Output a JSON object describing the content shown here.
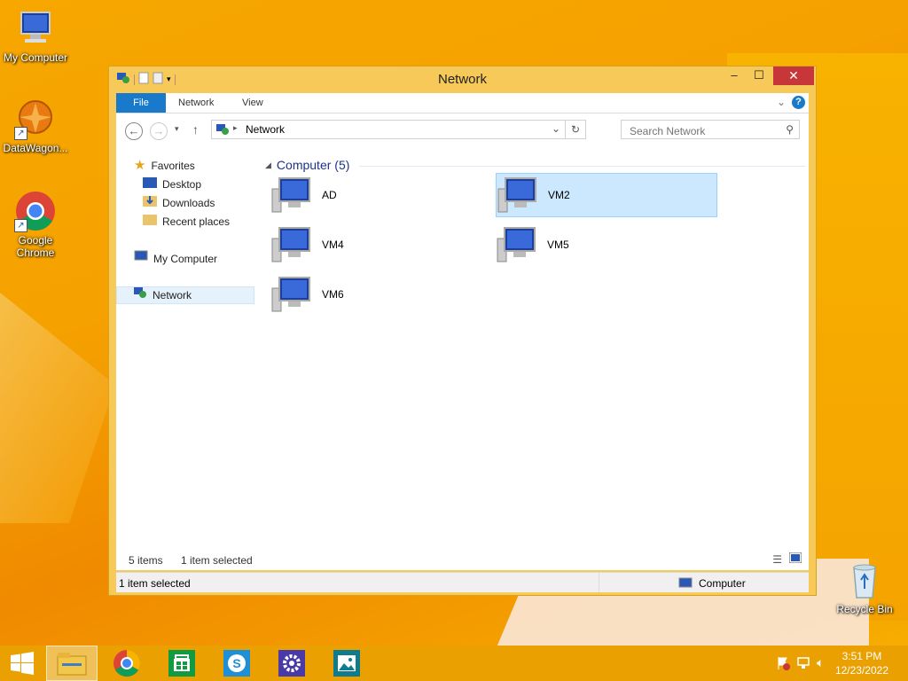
{
  "desktop": {
    "icons": [
      {
        "label": "My Computer"
      },
      {
        "label": "DataWagon..."
      },
      {
        "label": "Google Chrome"
      },
      {
        "label": "Recycle Bin"
      }
    ]
  },
  "window": {
    "title": "Network",
    "controls": {
      "minimize": "–",
      "maximize": "☐",
      "close": "✕"
    }
  },
  "ribbon": {
    "tabs": [
      {
        "label": "File"
      },
      {
        "label": "Network"
      },
      {
        "label": "View"
      }
    ],
    "help": "?"
  },
  "address": {
    "path": "Network",
    "search_placeholder": "Search Network"
  },
  "nav_pane": {
    "favorites": "Favorites",
    "favorite_items": [
      {
        "label": "Desktop"
      },
      {
        "label": "Downloads"
      },
      {
        "label": "Recent places"
      }
    ],
    "my_computer": "My Computer",
    "network": "Network"
  },
  "main": {
    "group_header": "Computer (5)",
    "items": [
      {
        "label": "AD",
        "selected": false
      },
      {
        "label": "VM2",
        "selected": true
      },
      {
        "label": "VM4",
        "selected": false
      },
      {
        "label": "VM5",
        "selected": false
      },
      {
        "label": "VM6",
        "selected": false
      }
    ]
  },
  "status": {
    "item_count": "5 items",
    "selection": "1 item selected",
    "details_left": "1 item selected",
    "details_right": "Computer"
  },
  "taskbar": {
    "apps": [
      {
        "icon": "file-explorer-icon"
      },
      {
        "icon": "chrome-icon"
      },
      {
        "icon": "store-icon"
      },
      {
        "icon": "skype-icon"
      },
      {
        "icon": "settings-icon"
      },
      {
        "icon": "photos-icon"
      }
    ],
    "time": "3:51 PM",
    "date": "12/23/2022"
  }
}
